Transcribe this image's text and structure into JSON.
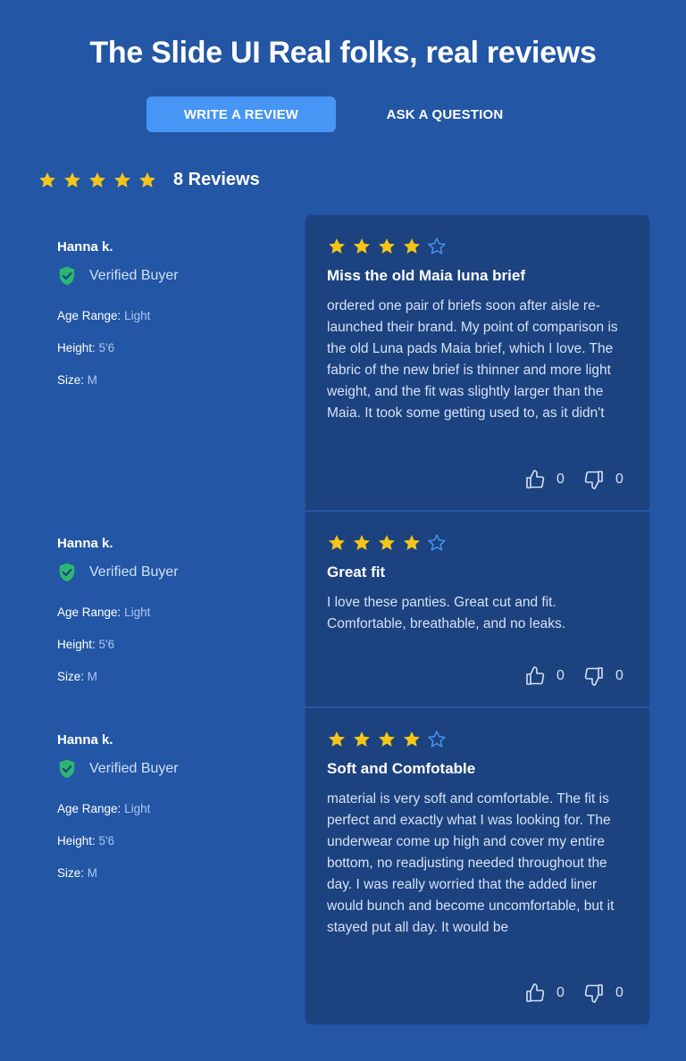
{
  "header": {
    "title": "The Slide UI Real folks, real reviews"
  },
  "actions": {
    "write_label": "Write a review",
    "ask_label": "Ask a question"
  },
  "summary": {
    "rating": 5,
    "count_label": "8 Reviews"
  },
  "colors": {
    "background": "#2356a4",
    "card": "#1c427f",
    "accent_button": "#4795f5",
    "star_filled": "#f5c518",
    "star_empty": "#4795f5",
    "verified": "#2bb673"
  },
  "labels": {
    "age_range": "Age Range:",
    "height": "Height:",
    "size": "Size:",
    "verified": "Verified Buyer"
  },
  "reviews": [
    {
      "name": "Hanna k.",
      "age_range": "Light",
      "height": "5'6",
      "size": "M",
      "rating": 4,
      "title": "Miss the old Maia luna brief",
      "body": "ordered one pair of briefs soon after aisle re-launched their brand. My point of comparison is the old Luna pads Maia brief, which I love. The fabric of the new brief is thinner and more light weight, and the fit was slightly larger than the Maia. It took some getting used to, as it didn't",
      "up": "0",
      "down": "0"
    },
    {
      "name": "Hanna k.",
      "age_range": "Light",
      "height": "5'6",
      "size": "M",
      "rating": 4,
      "title": "Great fit",
      "body": "I love these panties. Great cut and fit. Comfortable, breathable, and no leaks.",
      "up": "0",
      "down": "0"
    },
    {
      "name": "Hanna k.",
      "age_range": "Light",
      "height": "5'6",
      "size": "M",
      "rating": 4,
      "title": "Soft and Comfotable",
      "body": "material is very soft and comfortable. The fit is perfect and exactly what I was looking for. The underwear come up high and cover my entire bottom, no readjusting needed throughout the day. I was really worried that the added liner would bunch and become uncomfortable, but it stayed put all day. It would be",
      "up": "0",
      "down": "0"
    }
  ]
}
